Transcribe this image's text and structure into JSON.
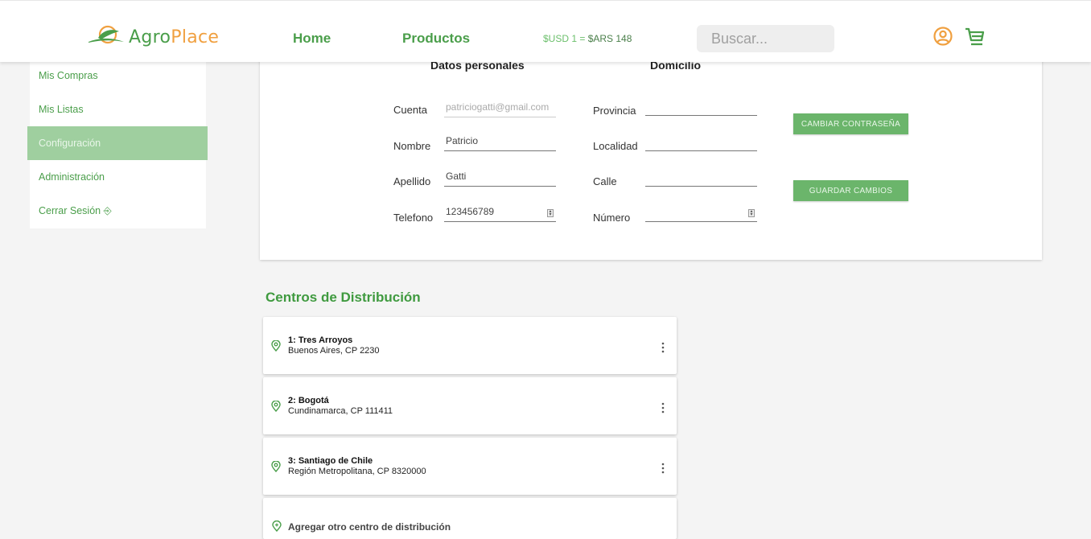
{
  "brand": {
    "part1": "Agro",
    "part2": "Place"
  },
  "nav": {
    "home": "Home",
    "productos": "Productos"
  },
  "rate": {
    "usd": "$USD 1 = ",
    "ars": "$ARS 148"
  },
  "search": {
    "placeholder": "Buscar..."
  },
  "sidebar": {
    "items": [
      {
        "label": "Mis Compras"
      },
      {
        "label": "Mis Listas"
      },
      {
        "label": "Configuración"
      },
      {
        "label": "Administración"
      },
      {
        "label": "Cerrar Sesión ⎆"
      }
    ]
  },
  "profile": {
    "personal_title": "Datos personales",
    "domicilio_title": "Domicilio",
    "fields": {
      "cuenta": {
        "label": "Cuenta",
        "value": "patriciogatti@gmail.com"
      },
      "nombre": {
        "label": "Nombre",
        "value": "Patricio"
      },
      "apellido": {
        "label": "Apellido",
        "value": "Gatti"
      },
      "telefono": {
        "label": "Telefono",
        "value": "123456789"
      },
      "provincia": {
        "label": "Provincia",
        "value": ""
      },
      "localidad": {
        "label": "Localidad",
        "value": ""
      },
      "calle": {
        "label": "Calle",
        "value": ""
      },
      "numero": {
        "label": "Número",
        "value": ""
      }
    },
    "buttons": {
      "cambiar": "CAMBIAR CONTRASEÑA",
      "guardar": "GUARDAR CAMBIOS"
    }
  },
  "centros": {
    "title": "Centros de Distribución",
    "items": [
      {
        "name": "1: Tres Arroyos",
        "sub": "Buenos Aires, CP 2230"
      },
      {
        "name": "2: Bogotá",
        "sub": "Cundinamarca, CP 111411"
      },
      {
        "name": "3: Santiago de Chile",
        "sub": "Región Metropolitana, CP 8320000"
      }
    ],
    "add_label": "Agregar otro centro de distribución"
  },
  "colors": {
    "brand_green": "#4a9e4a",
    "brand_orange": "#f0a040",
    "active_item": "#9fcf9f"
  }
}
